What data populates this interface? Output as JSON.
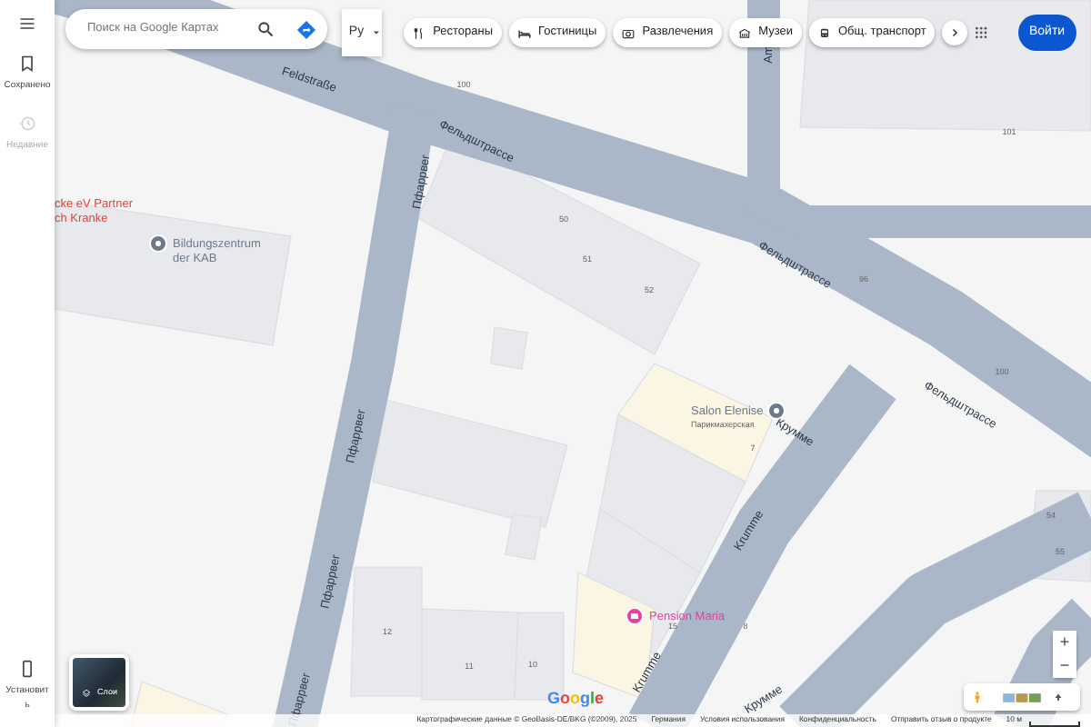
{
  "sidebar": {
    "items": [
      {
        "kind": "menu",
        "disabled": false
      },
      {
        "kind": "saved",
        "label": "Сохранено",
        "disabled": false
      },
      {
        "kind": "recent",
        "label": "Недавние",
        "disabled": true
      },
      {
        "kind": "install",
        "label": "Установить",
        "disabled": false
      }
    ]
  },
  "search": {
    "placeholder": "Поиск на Google Картах"
  },
  "language": {
    "value": "Ру"
  },
  "chips": [
    {
      "kind": "restaurant",
      "label": "Рестораны"
    },
    {
      "kind": "hotel",
      "label": "Гостиницы"
    },
    {
      "kind": "attraction",
      "label": "Развлечения"
    },
    {
      "kind": "museum",
      "label": "Музеи"
    },
    {
      "kind": "transit",
      "label": "Общ. транспорт"
    }
  ],
  "sign_in": {
    "label": "Войти"
  },
  "map": {
    "labels": [
      {
        "kind": "street",
        "text": "Feldstraße"
      },
      {
        "kind": "street",
        "text": "Фельдштрассе"
      },
      {
        "kind": "street",
        "text": "Фельдштрассе"
      },
      {
        "kind": "street",
        "text": "Фельдштрассе"
      },
      {
        "kind": "street",
        "text": "Пфаррвег"
      },
      {
        "kind": "street",
        "text": "Пфаррвег"
      },
      {
        "kind": "street",
        "text": "Пфаррвег"
      },
      {
        "kind": "street",
        "text": "Пфаррвег"
      },
      {
        "kind": "street",
        "text": "Am"
      },
      {
        "kind": "street",
        "text": "Krumme"
      },
      {
        "kind": "street",
        "text": "Крумме"
      },
      {
        "kind": "street",
        "text": "Krumme"
      },
      {
        "kind": "street",
        "text": "Крумме"
      },
      {
        "kind": "number",
        "text": "100"
      },
      {
        "kind": "number",
        "text": "101"
      },
      {
        "kind": "number",
        "text": "50"
      },
      {
        "kind": "number",
        "text": "51"
      },
      {
        "kind": "number",
        "text": "52"
      },
      {
        "kind": "number",
        "text": "96"
      },
      {
        "kind": "number",
        "text": "100"
      },
      {
        "kind": "number",
        "text": "7"
      },
      {
        "kind": "number",
        "text": "12"
      },
      {
        "kind": "number",
        "text": "11"
      },
      {
        "kind": "number",
        "text": "10"
      },
      {
        "kind": "number",
        "text": "54"
      },
      {
        "kind": "number",
        "text": "55"
      },
      {
        "kind": "number",
        "text": "15"
      },
      {
        "kind": "number",
        "text": "8"
      }
    ],
    "places": [
      {
        "kind": "cut",
        "lines": [
          "cke eV Partner",
          "ch Kranke"
        ],
        "color": "#e0463e"
      },
      {
        "kind": "generic",
        "lines": [
          "Bildungszentrum",
          "der KAB"
        ],
        "color": "#6b7b8c"
      },
      {
        "kind": "generic",
        "lines": [
          "Salon Elenise"
        ],
        "subtitle": "Парикмахерская",
        "color": "#6b7b8c"
      },
      {
        "kind": "hotel",
        "lines": [
          "Pension Maria"
        ],
        "color": "#e93fa0"
      }
    ]
  },
  "layers": {
    "label": "Слои"
  },
  "logo": "Google",
  "zoom": {
    "in": "+",
    "out": "−"
  },
  "footer": [
    "Картографические данные © GeoBasis-DE/BKG (©2009), 2025",
    "Германия",
    "Условия использования",
    "Конфиденциальность",
    "Отправить отзыв о продукте"
  ],
  "scale": "10 м"
}
